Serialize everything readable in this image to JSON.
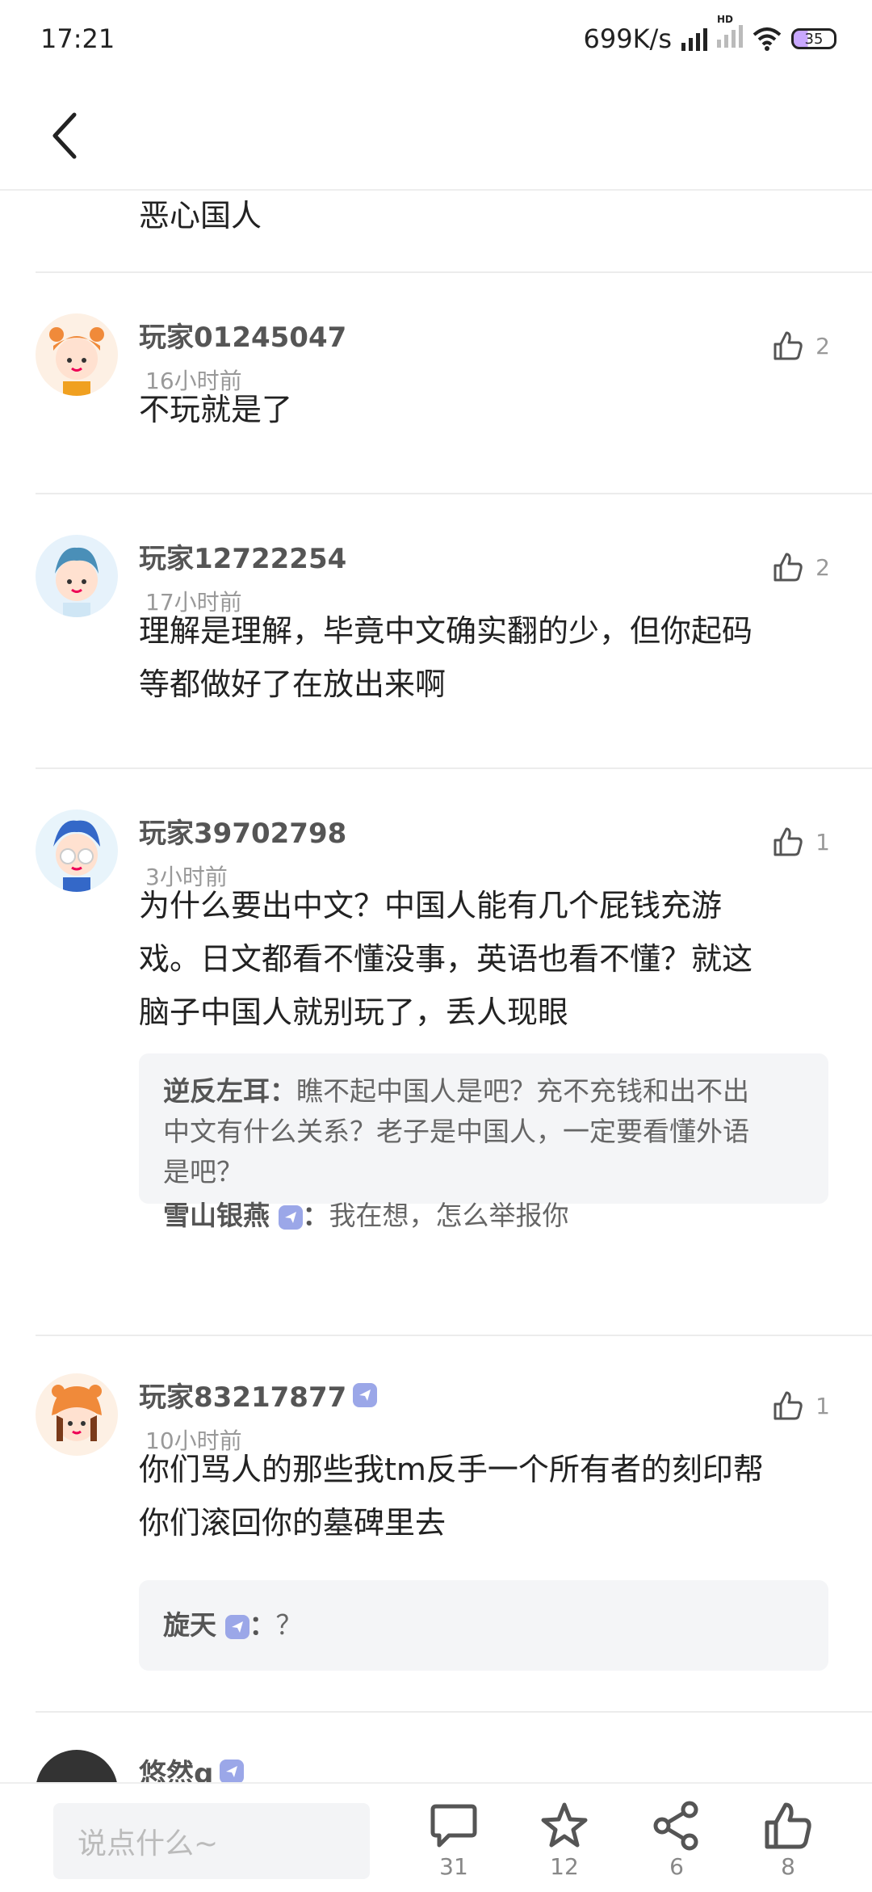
{
  "status": {
    "time": "17:21",
    "speed": "699K/s",
    "battery": "35",
    "hd": "HD"
  },
  "feed": {
    "top_text": "恶心国人",
    "comments": [
      {
        "name": "玩家01245047",
        "time": "16小时前",
        "likes": "2",
        "text": "不玩就是了"
      },
      {
        "name": "玩家12722254",
        "time": "17小时前",
        "likes": "2",
        "text_lines": [
          "理解是理解，毕竟中文确实翻的少，但你起码",
          "等都做好了在放出来啊"
        ]
      },
      {
        "name": "玩家39702798",
        "time": "3小时前",
        "likes": "1",
        "text_lines": [
          "为什么要出中文？中国人能有几个屁钱充游",
          "戏。日文都看不懂没事，英语也看不懂？就这",
          "脑子中国人就别玩了，丢人现眼"
        ],
        "replies": [
          {
            "name": "逆反左耳",
            "sep": "：",
            "text_lines": [
              "瞧不起中国人是吧？充不充钱和出不出",
              "中文有什么关系？老子是中国人，一定要看懂外语",
              "是吧？"
            ]
          },
          {
            "name": "雪山银燕",
            "sep": "：",
            "text": "我在想，怎么举报你"
          }
        ]
      },
      {
        "name": "玩家83217877",
        "time": "10小时前",
        "likes": "1",
        "text_lines": [
          "你们骂人的那些我tm反手一个所有者的刻印帮",
          "你们滚回你的墓碑里去"
        ],
        "replies": [
          {
            "name": "旋天",
            "sep": "：",
            "text": "？"
          }
        ]
      },
      {
        "name": "悠然g"
      }
    ]
  },
  "bottom": {
    "placeholder": "说点什么~",
    "comment_count": "31",
    "favorite_count": "12",
    "share_count": "6",
    "like_count": "8"
  },
  "colors": {
    "verified": "#9ba7e8",
    "text": "#222222",
    "muted": "#999999"
  },
  "icons": [
    "back-icon",
    "thumbs-up-icon",
    "verified-icon",
    "comment-icon",
    "star-icon",
    "share-icon",
    "wifi-icon",
    "signal-icon",
    "battery-icon"
  ]
}
